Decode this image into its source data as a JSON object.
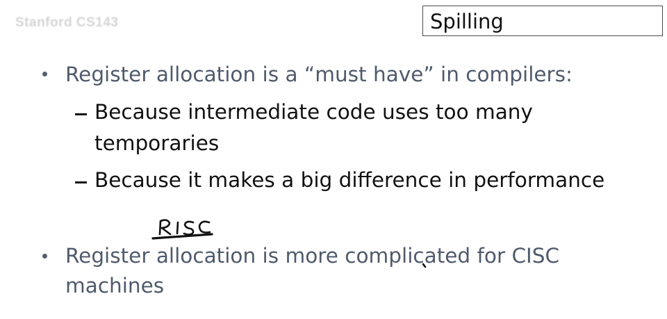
{
  "watermark": "Stanford CS143",
  "slide": {
    "title": "Spilling",
    "bullet1": "Register allocation is a “must have” in compilers:",
    "sub1_line1": "Because intermediate code uses too many",
    "sub1_line2": "temporaries",
    "sub2": "Because it makes a big difference in performance",
    "bullet2_line1": "Register allocation is more complicated for CISC",
    "bullet2_line2": "machines",
    "handwritten_annotation": "RISC"
  },
  "colors": {
    "bullet_text": "#4f5a6b",
    "sub_text": "#111111",
    "ink": "#111111"
  }
}
